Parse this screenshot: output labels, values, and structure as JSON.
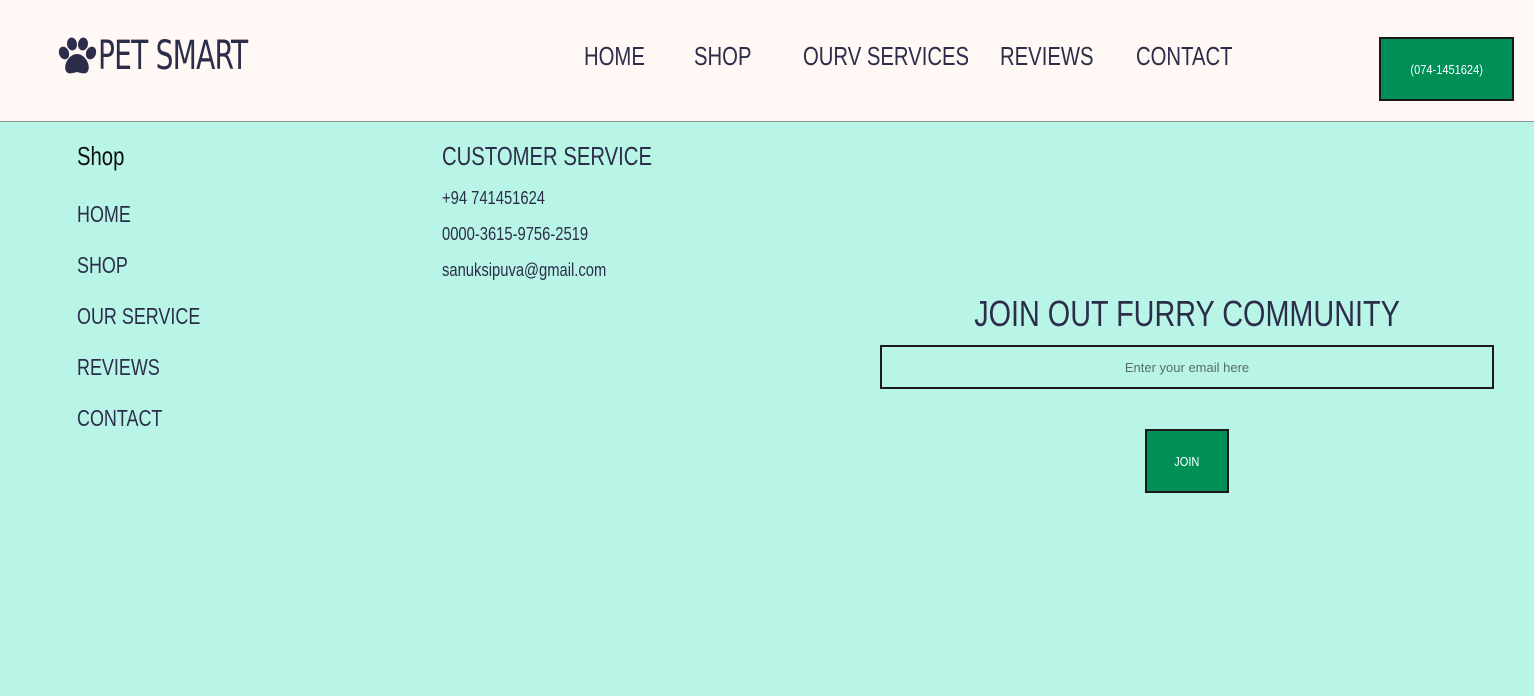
{
  "brand": {
    "name": "PET SMART",
    "icon": "paw-icon"
  },
  "nav": {
    "items": [
      "HOME",
      "SHOP",
      "OURV SERVICES",
      "REVIEWS",
      "CONTACT"
    ]
  },
  "header": {
    "phone_button_label": "(074-1451624)"
  },
  "footer": {
    "shop": {
      "title": "Shop",
      "links": [
        "HOME",
        "SHOP",
        "OUR SERVICE",
        "REVIEWS",
        "CONTACT"
      ]
    },
    "customer_service": {
      "title": "CUSTOMER SERVICE",
      "phone": "+94 741451624",
      "card": "0000-3615-9756-2519",
      "email": "sanuksipuva@gmail.com"
    },
    "newsletter": {
      "title": "JOIN OUT FURRY COMMUNITY",
      "email_placeholder": "Enter your email here",
      "join_label": "JOIN"
    }
  },
  "colors": {
    "header_bg": "#fff8f4",
    "page_bg": "#b9f5e7",
    "accent_green": "#008f57",
    "text_navy": "#2b2d4a"
  }
}
